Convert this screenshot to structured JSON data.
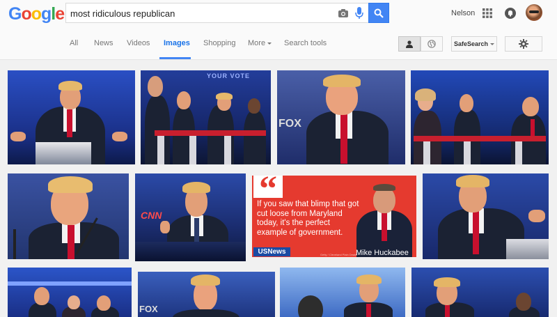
{
  "logo": {
    "text": "Google",
    "letters": [
      {
        "ch": "G",
        "color": "#4285f4"
      },
      {
        "ch": "o",
        "color": "#ea4335"
      },
      {
        "ch": "o",
        "color": "#fbbc05"
      },
      {
        "ch": "g",
        "color": "#4285f4"
      },
      {
        "ch": "l",
        "color": "#34a853"
      },
      {
        "ch": "e",
        "color": "#ea4335"
      }
    ]
  },
  "search": {
    "query": "most ridiculous republican",
    "camera_icon": "camera-icon",
    "mic_icon": "mic-icon",
    "button_icon": "magnifier-icon"
  },
  "account": {
    "name": "Nelson",
    "apps_icon": "apps-grid-icon",
    "notifications_icon": "bell-icon"
  },
  "nav": {
    "tabs": [
      {
        "label": "All"
      },
      {
        "label": "News"
      },
      {
        "label": "Videos"
      },
      {
        "label": "Images",
        "active": true
      },
      {
        "label": "Shopping"
      },
      {
        "label": "More"
      },
      {
        "label": "Search tools"
      }
    ],
    "tools": {
      "safesearch_label": "SafeSearch"
    }
  },
  "quote_card": {
    "quote_mark": "“",
    "text": "If you saw that blimp that got cut loose from Maryland today, it's the perfect example of government.",
    "source": "USNews",
    "credit": "Getty / Cleveland Plain Dealer",
    "attribution": "Mike Huckabee"
  },
  "image_labels": {
    "fox": "FOX",
    "cnn": "CNN",
    "watermark": "YOUR VOTE"
  },
  "colors": {
    "accent": "#4285f4",
    "tie": "#c8102e",
    "stage_blue": "#1f3fa8",
    "quote_red": "#e53a2f"
  }
}
